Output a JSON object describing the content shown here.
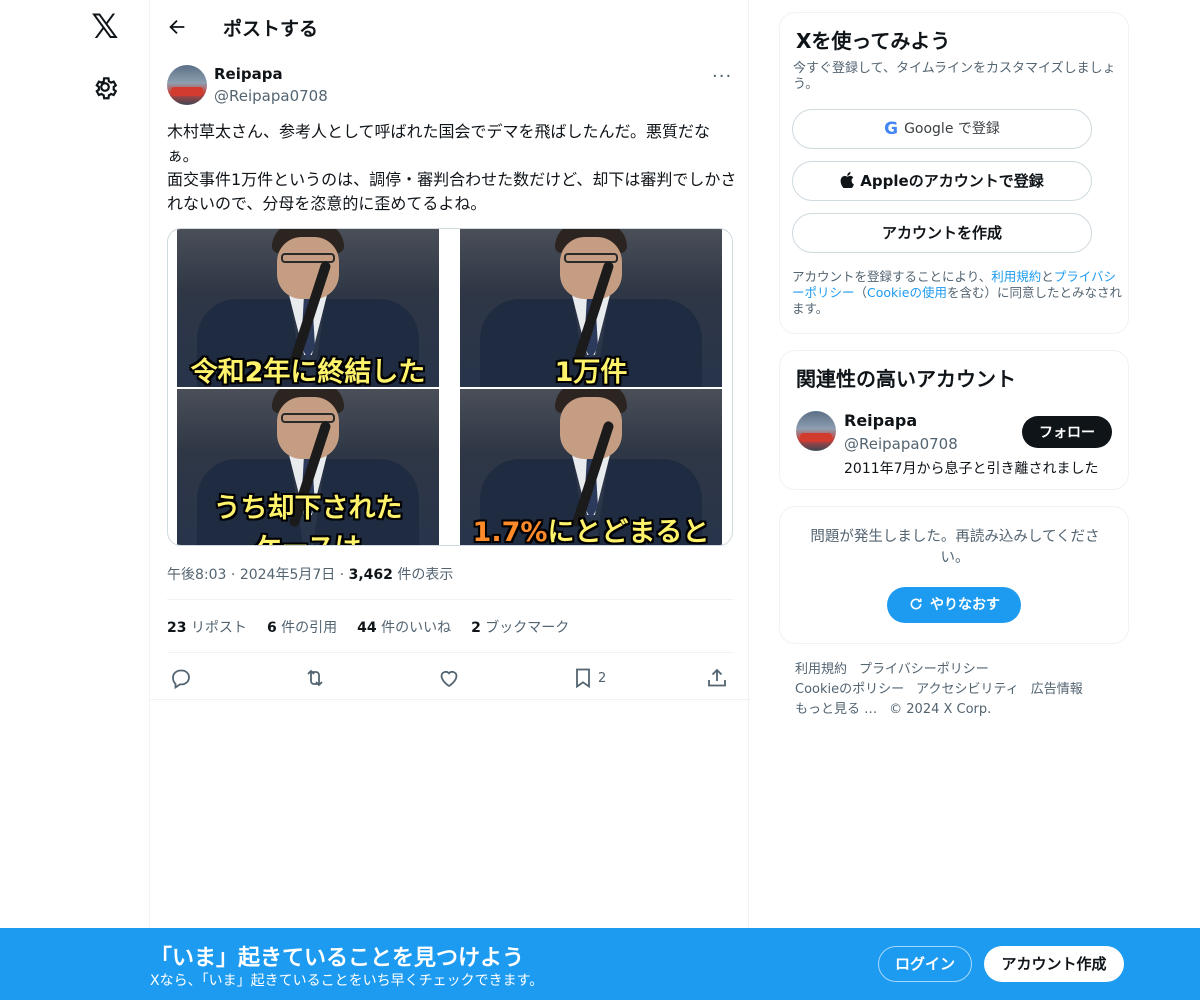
{
  "nav": {
    "logo": "𝕏"
  },
  "header": {
    "title": "ポストする"
  },
  "post": {
    "author_name": "Reipapa",
    "author_handle": "@Reipapa0708",
    "more": "···",
    "text_lines": [
      "木村草太さん、参考人として呼ばれた国会でデマを飛ばしたんだ。悪質だなぁ。",
      "面交事件1万件というのは、調停・審判合わせた数だけど、却下は審判でしかされないので、分母を恣意的に歪めてるよね。"
    ],
    "media_captions": [
      {
        "text": "令和2年に終結した",
        "highlight": ""
      },
      {
        "text": "1万件",
        "highlight": ""
      },
      {
        "text": "うち却下された",
        "sub": "ケースは",
        "highlight": ""
      },
      {
        "text": "にとどまると",
        "highlight": "1.7%"
      }
    ],
    "time": "午後8:03",
    "date": "2024年5月7日",
    "views": "3,462",
    "views_label": "件の表示",
    "sep": "·",
    "stats": [
      {
        "count": "23",
        "label": "リポスト"
      },
      {
        "count": "6",
        "label": "件の引用"
      },
      {
        "count": "44",
        "label": "件のいいね"
      },
      {
        "count": "2",
        "label": "ブックマーク"
      }
    ],
    "bookmark_count": "2"
  },
  "signup_card": {
    "title": "Xを使ってみよう",
    "subtitle": "今すぐ登録して、タイムラインをカスタマイズしましょう。",
    "google_logo": "G",
    "google_label": "Google で登録",
    "apple_label": "Appleのアカウントで登録",
    "create_label": "アカウントを作成",
    "legal_1": "アカウントを登録することにより、",
    "legal_terms": "利用規約",
    "legal_and": "と",
    "legal_privacy": "プライバシーポリシー",
    "legal_2": "（",
    "legal_cookie": "Cookieの使用",
    "legal_3": "を含む）に同意したとみなされます。"
  },
  "related_card": {
    "title": "関連性の高いアカウント",
    "name": "Reipapa",
    "handle": "@Reipapa0708",
    "bio": "2011年7月から息子と引き離されました",
    "follow_label": "フォロー"
  },
  "error_card": {
    "message": "問題が発生しました。再読み込みしてください。",
    "retry_label": "やりなおす"
  },
  "footer": {
    "links": [
      "利用規約",
      "プライバシーポリシー",
      "Cookieのポリシー",
      "アクセシビリティ",
      "広告情報",
      "もっと見る …"
    ],
    "copyright": "© 2024 X Corp."
  },
  "banner": {
    "title": "「いま」起きていることを見つけよう",
    "subtitle": "Xなら、「いま」起きていることをいち早くチェックできます。",
    "login_label": "ログイン",
    "signup_label": "アカウント作成"
  },
  "colors": {
    "accent": "#1d9bf0",
    "text": "#0f1419",
    "muted": "#536471"
  }
}
